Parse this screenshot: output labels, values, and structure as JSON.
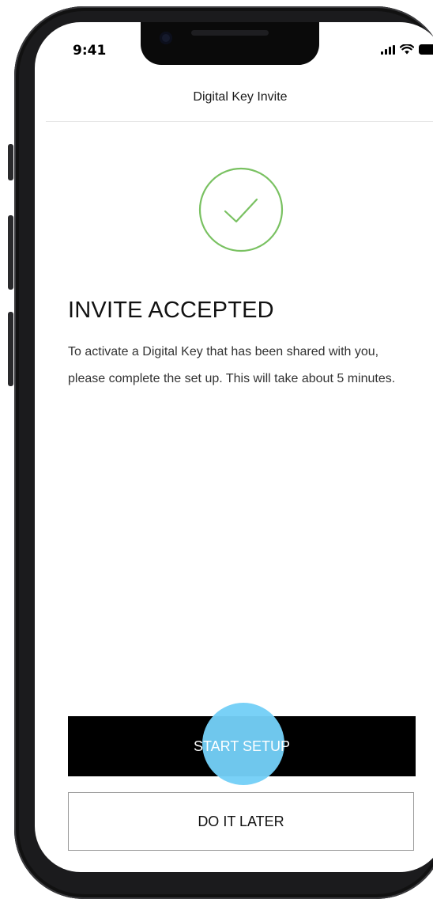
{
  "status_bar": {
    "time": "9:41"
  },
  "nav": {
    "title": "Digital Key Invite"
  },
  "content": {
    "heading": "INVITE ACCEPTED",
    "body": "To activate a Digital Key that has been shared with you, please complete the set up. This will take about 5 minutes.",
    "success_icon": "checkmark-circle-icon",
    "success_color": "#79c161"
  },
  "actions": {
    "primary_label": "START SETUP",
    "secondary_label": "DO IT LATER",
    "primary_color": "#000000",
    "tap_indicator_color": "#74cff7"
  }
}
